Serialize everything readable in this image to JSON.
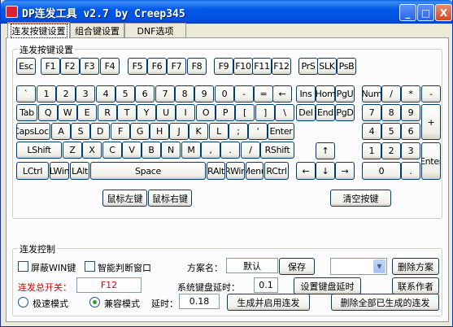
{
  "window": {
    "title": "DP连发工具 v2.7 by Creep345",
    "controls": {
      "minimize": "_",
      "maximize": "□",
      "close": "X"
    }
  },
  "tabs": [
    "连发按键设置",
    "组合键设置",
    "DNF选项"
  ],
  "keys_group": {
    "legend": "连发按键设置",
    "fn_row": [
      "Esc",
      "F1",
      "F2",
      "F3",
      "F4",
      "F5",
      "F6",
      "F7",
      "F8",
      "F9",
      "F10",
      "F11",
      "F12",
      "PrS",
      "SLK",
      "PsB"
    ],
    "main_row1": [
      "`",
      "1",
      "2",
      "3",
      "4",
      "5",
      "6",
      "7",
      "8",
      "9",
      "0",
      "-",
      "=",
      "←"
    ],
    "main_row2": [
      "Tab",
      "Q",
      "W",
      "E",
      "R",
      "T",
      "Y",
      "U",
      "I",
      "O",
      "P",
      "[",
      "]",
      "\\"
    ],
    "main_row3": [
      "CapsLock",
      "A",
      "S",
      "D",
      "F",
      "G",
      "H",
      "J",
      "K",
      "L",
      ";",
      "'",
      "Enter"
    ],
    "main_row4": [
      "LShift",
      "Z",
      "X",
      "C",
      "V",
      "B",
      "N",
      "M",
      ",",
      ".",
      "/",
      "RShift"
    ],
    "main_row5": [
      "LCtrl",
      "LWin",
      "LAlt",
      "Space",
      "RAlt",
      "RWin",
      "Menu",
      "RCtrl"
    ],
    "nav_row1": [
      "Ins",
      "Hom",
      "PgU"
    ],
    "nav_row2": [
      "Del",
      "End",
      "PgD"
    ],
    "arrows": [
      "↑",
      "←",
      "↓",
      "→"
    ],
    "numpad": {
      "row1": [
        "Num",
        "/",
        "*",
        "-"
      ],
      "row2": [
        "7",
        "8",
        "9"
      ],
      "row3": [
        "4",
        "5",
        "6"
      ],
      "row4": [
        "1",
        "2",
        "3"
      ],
      "plus": "+",
      "zero": "0",
      "dot": ".",
      "enter": "Enter"
    },
    "mouse_left": "鼠标左键",
    "mouse_right": "鼠标右键",
    "clear_keys": "清空按键"
  },
  "control_group": {
    "legend": "连发控制",
    "block_win_label": "屏蔽WIN键",
    "smart_window_label": "智能判断窗口",
    "master_switch_label": "连发总开关：",
    "master_switch_value": "F12",
    "mode_extreme_label": "极速模式",
    "mode_compat_label": "兼容模式",
    "delay_label": "延时：",
    "delay_value": "0.18",
    "generate_button": "生成并启用连发",
    "scheme_label": "方案名：",
    "scheme_value": "默认",
    "save_button": "保存",
    "delete_scheme_button": "删除方案",
    "sys_delay_label": "系统键盘延时：",
    "sys_delay_value": "0.1",
    "set_sys_delay_button": "设置键盘延时",
    "contact_button": "联系作者",
    "delete_all_button": "删除全部已生成的连发"
  },
  "colors": {
    "accent": "#e00000",
    "title_bar": "#0058e8"
  }
}
